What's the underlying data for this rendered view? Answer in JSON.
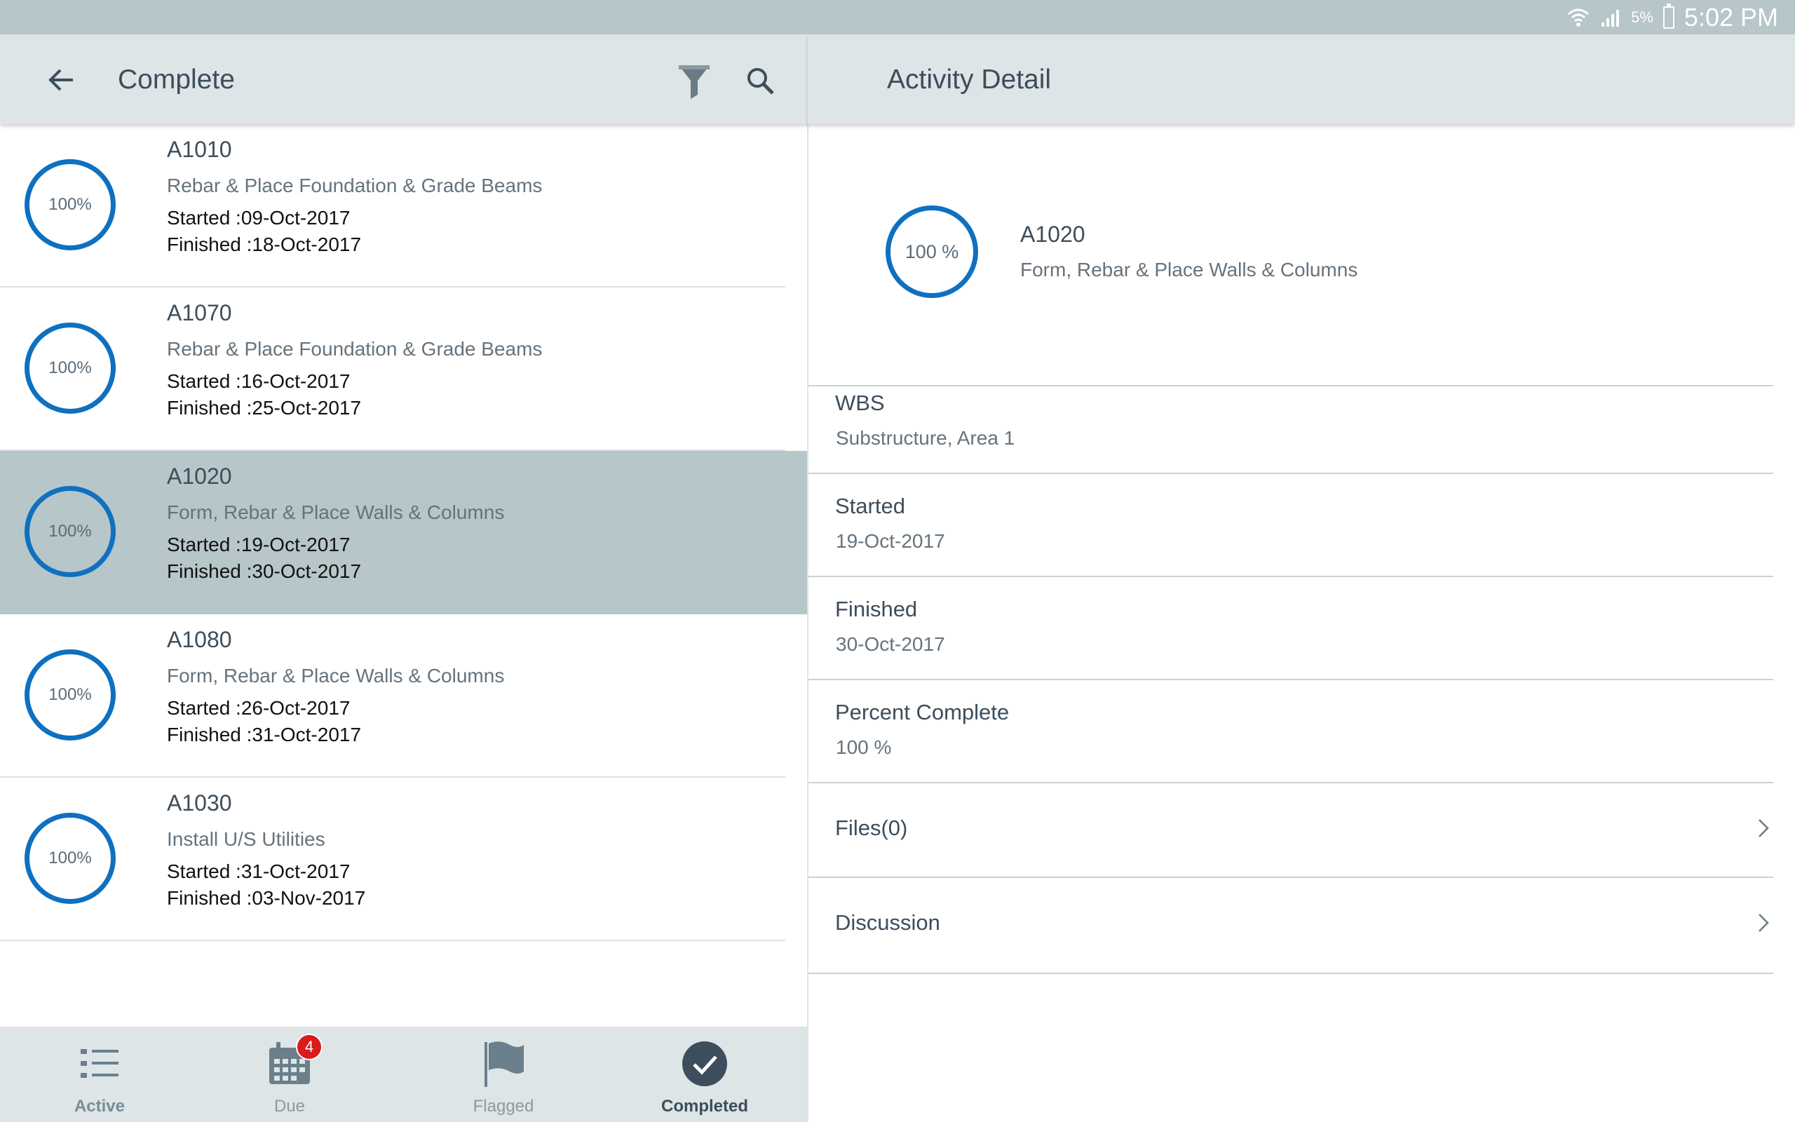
{
  "status_bar": {
    "battery": "5%",
    "time": "5:02 PM"
  },
  "list_header": {
    "title": "Complete"
  },
  "detail_header": {
    "title": "Activity Detail"
  },
  "activities": [
    {
      "code": "A1010",
      "description": "Rebar & Place Foundation & Grade Beams",
      "started": "Started :09-Oct-2017",
      "finished": "Finished :18-Oct-2017",
      "percent": "100%"
    },
    {
      "code": "A1070",
      "description": "Rebar & Place Foundation & Grade Beams",
      "started": "Started :16-Oct-2017",
      "finished": "Finished :25-Oct-2017",
      "percent": "100%"
    },
    {
      "code": "A1020",
      "description": "Form, Rebar & Place Walls & Columns",
      "started": "Started :19-Oct-2017",
      "finished": "Finished :30-Oct-2017",
      "percent": "100%"
    },
    {
      "code": "A1080",
      "description": "Form, Rebar & Place Walls & Columns",
      "started": "Started :26-Oct-2017",
      "finished": "Finished :31-Oct-2017",
      "percent": "100%"
    },
    {
      "code": "A1030",
      "description": "Install U/S Utilities",
      "started": "Started :31-Oct-2017",
      "finished": "Finished :03-Nov-2017",
      "percent": "100%"
    }
  ],
  "bottom_nav": {
    "active": "Active",
    "due": "Due",
    "due_badge": "4",
    "flagged": "Flagged",
    "completed": "Completed"
  },
  "detail": {
    "percent": "100 %",
    "code": "A1020",
    "description": "Form, Rebar & Place Walls & Columns",
    "wbs_label": "WBS",
    "wbs_value": "Substructure, Area 1",
    "started_label": "Started",
    "started_value": "19-Oct-2017",
    "finished_label": "Finished",
    "finished_value": "30-Oct-2017",
    "percent_label": "Percent Complete",
    "percent_value": "100 %",
    "files_label": "Files(0)",
    "discussion_label": "Discussion"
  },
  "colors": {
    "progress_ring": "#0f70c0",
    "selected_row": "#b6c6c9",
    "app_bar": "#dde5e6",
    "badge": "#d81b1b"
  }
}
